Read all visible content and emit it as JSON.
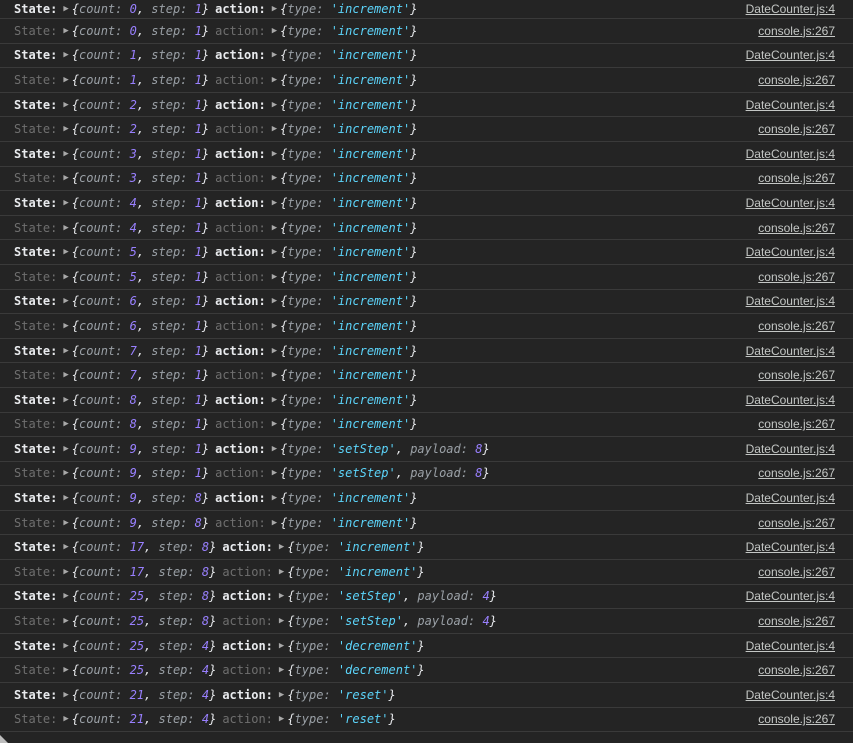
{
  "state_label": "State:",
  "action_label": "action:",
  "rows": [
    {
      "count": "0",
      "step": "1",
      "type": "'increment'",
      "payload": "",
      "src": "DateCounter.js:4",
      "muted": false
    },
    {
      "count": "0",
      "step": "1",
      "type": "'increment'",
      "payload": "",
      "src": "console.js:267",
      "muted": true
    },
    {
      "count": "1",
      "step": "1",
      "type": "'increment'",
      "payload": "",
      "src": "DateCounter.js:4",
      "muted": false
    },
    {
      "count": "1",
      "step": "1",
      "type": "'increment'",
      "payload": "",
      "src": "console.js:267",
      "muted": true
    },
    {
      "count": "2",
      "step": "1",
      "type": "'increment'",
      "payload": "",
      "src": "DateCounter.js:4",
      "muted": false
    },
    {
      "count": "2",
      "step": "1",
      "type": "'increment'",
      "payload": "",
      "src": "console.js:267",
      "muted": true
    },
    {
      "count": "3",
      "step": "1",
      "type": "'increment'",
      "payload": "",
      "src": "DateCounter.js:4",
      "muted": false
    },
    {
      "count": "3",
      "step": "1",
      "type": "'increment'",
      "payload": "",
      "src": "console.js:267",
      "muted": true
    },
    {
      "count": "4",
      "step": "1",
      "type": "'increment'",
      "payload": "",
      "src": "DateCounter.js:4",
      "muted": false
    },
    {
      "count": "4",
      "step": "1",
      "type": "'increment'",
      "payload": "",
      "src": "console.js:267",
      "muted": true
    },
    {
      "count": "5",
      "step": "1",
      "type": "'increment'",
      "payload": "",
      "src": "DateCounter.js:4",
      "muted": false
    },
    {
      "count": "5",
      "step": "1",
      "type": "'increment'",
      "payload": "",
      "src": "console.js:267",
      "muted": true
    },
    {
      "count": "6",
      "step": "1",
      "type": "'increment'",
      "payload": "",
      "src": "DateCounter.js:4",
      "muted": false
    },
    {
      "count": "6",
      "step": "1",
      "type": "'increment'",
      "payload": "",
      "src": "console.js:267",
      "muted": true
    },
    {
      "count": "7",
      "step": "1",
      "type": "'increment'",
      "payload": "",
      "src": "DateCounter.js:4",
      "muted": false
    },
    {
      "count": "7",
      "step": "1",
      "type": "'increment'",
      "payload": "",
      "src": "console.js:267",
      "muted": true
    },
    {
      "count": "8",
      "step": "1",
      "type": "'increment'",
      "payload": "",
      "src": "DateCounter.js:4",
      "muted": false
    },
    {
      "count": "8",
      "step": "1",
      "type": "'increment'",
      "payload": "",
      "src": "console.js:267",
      "muted": true
    },
    {
      "count": "9",
      "step": "1",
      "type": "'setStep'",
      "payload": "8",
      "src": "DateCounter.js:4",
      "muted": false
    },
    {
      "count": "9",
      "step": "1",
      "type": "'setStep'",
      "payload": "8",
      "src": "console.js:267",
      "muted": true
    },
    {
      "count": "9",
      "step": "8",
      "type": "'increment'",
      "payload": "",
      "src": "DateCounter.js:4",
      "muted": false
    },
    {
      "count": "9",
      "step": "8",
      "type": "'increment'",
      "payload": "",
      "src": "console.js:267",
      "muted": true
    },
    {
      "count": "17",
      "step": "8",
      "type": "'increment'",
      "payload": "",
      "src": "DateCounter.js:4",
      "muted": false
    },
    {
      "count": "17",
      "step": "8",
      "type": "'increment'",
      "payload": "",
      "src": "console.js:267",
      "muted": true
    },
    {
      "count": "25",
      "step": "8",
      "type": "'setStep'",
      "payload": "4",
      "src": "DateCounter.js:4",
      "muted": false
    },
    {
      "count": "25",
      "step": "8",
      "type": "'setStep'",
      "payload": "4",
      "src": "console.js:267",
      "muted": true
    },
    {
      "count": "25",
      "step": "4",
      "type": "'decrement'",
      "payload": "",
      "src": "DateCounter.js:4",
      "muted": false
    },
    {
      "count": "25",
      "step": "4",
      "type": "'decrement'",
      "payload": "",
      "src": "console.js:267",
      "muted": true
    },
    {
      "count": "21",
      "step": "4",
      "type": "'reset'",
      "payload": "",
      "src": "DateCounter.js:4",
      "muted": false
    },
    {
      "count": "21",
      "step": "4",
      "type": "'reset'",
      "payload": "",
      "src": "console.js:267",
      "muted": true
    }
  ]
}
